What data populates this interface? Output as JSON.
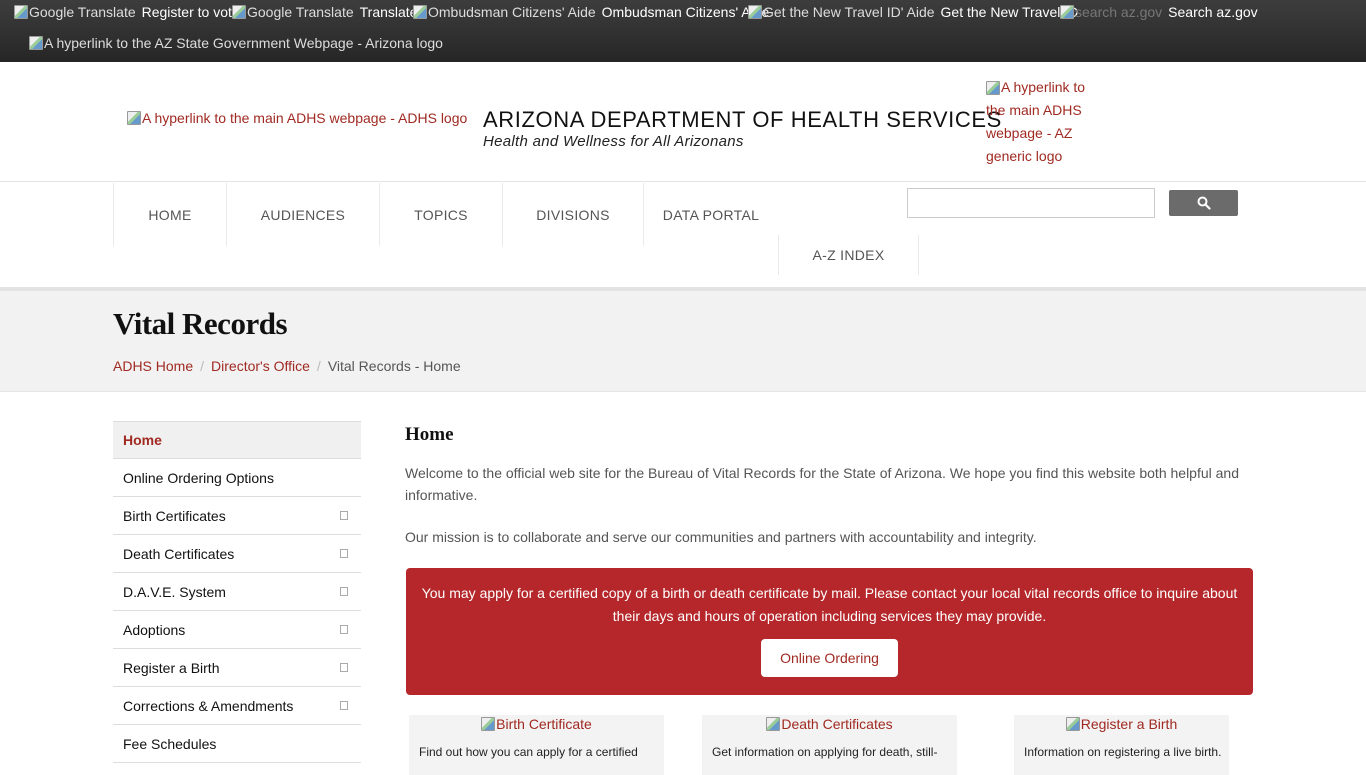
{
  "topbar": {
    "items": [
      {
        "img_alt": "Google Translate",
        "label": "Register to vote"
      },
      {
        "img_alt": "Google Translate",
        "label": "Translate"
      },
      {
        "img_alt": "Ombudsman Citizens' Aide",
        "label": "Ombudsman Citizens' Aide"
      },
      {
        "img_alt": "Get the New Travel ID' Aide",
        "label": "Get the New Travel ID"
      },
      {
        "img_alt": "search az.gov",
        "label": "Search az.gov"
      }
    ],
    "az_logo_alt": "A hyperlink to the AZ State Government Webpage - Arizona logo"
  },
  "header": {
    "adhs_logo_alt": "A hyperlink to the main ADHS webpage - ADHS logo",
    "title": "ARIZONA DEPARTMENT OF HEALTH SERVICES",
    "subtitle": "Health and Wellness for All Arizonans",
    "az_logo_alt": "A hyperlink to the main ADHS webpage - AZ generic logo"
  },
  "nav": {
    "items": [
      "HOME",
      "AUDIENCES",
      "TOPICS",
      "DIVISIONS",
      "DATA PORTAL",
      "A-Z INDEX"
    ],
    "search_placeholder": ""
  },
  "page": {
    "title": "Vital Records",
    "breadcrumb": [
      "ADHS Home",
      "Director's Office",
      "Vital Records - Home"
    ]
  },
  "sidebar": {
    "items": [
      {
        "label": "Home",
        "active": true,
        "expandable": false
      },
      {
        "label": "Online Ordering Options",
        "active": false,
        "expandable": false
      },
      {
        "label": "Birth Certificates",
        "active": false,
        "expandable": true
      },
      {
        "label": "Death Certificates",
        "active": false,
        "expandable": true
      },
      {
        "label": "D.A.V.E. System",
        "active": false,
        "expandable": true
      },
      {
        "label": "Adoptions",
        "active": false,
        "expandable": true
      },
      {
        "label": "Register a Birth",
        "active": false,
        "expandable": true
      },
      {
        "label": "Corrections & Amendments",
        "active": false,
        "expandable": true
      },
      {
        "label": "Fee Schedules",
        "active": false,
        "expandable": false
      }
    ]
  },
  "main": {
    "heading": "Home",
    "para1": "Welcome to the official web site for the Bureau of Vital Records for the State of Arizona. We hope you find this website both helpful and informative.",
    "para2": "Our mission is to collaborate and serve our communities and partners with accountability and integrity.",
    "alert": {
      "text": "You may apply for a certified copy of a birth or death certificate by mail. Please contact your local vital records office to inquire about their days and hours of operation including services they may provide.",
      "button": "Online Ordering"
    },
    "cards": [
      {
        "img_alt": "Birth Certificate",
        "text": "Find out how you can apply for a certified"
      },
      {
        "img_alt": "Death Certificates",
        "text": "Get information on applying for death, still-"
      },
      {
        "img_alt": "Register a Birth",
        "text": "Information on registering a live birth."
      }
    ]
  },
  "colors": {
    "accent": "#a02a22",
    "alert_bg": "#b5272a",
    "topbar_bg": "#2f2f2f"
  }
}
